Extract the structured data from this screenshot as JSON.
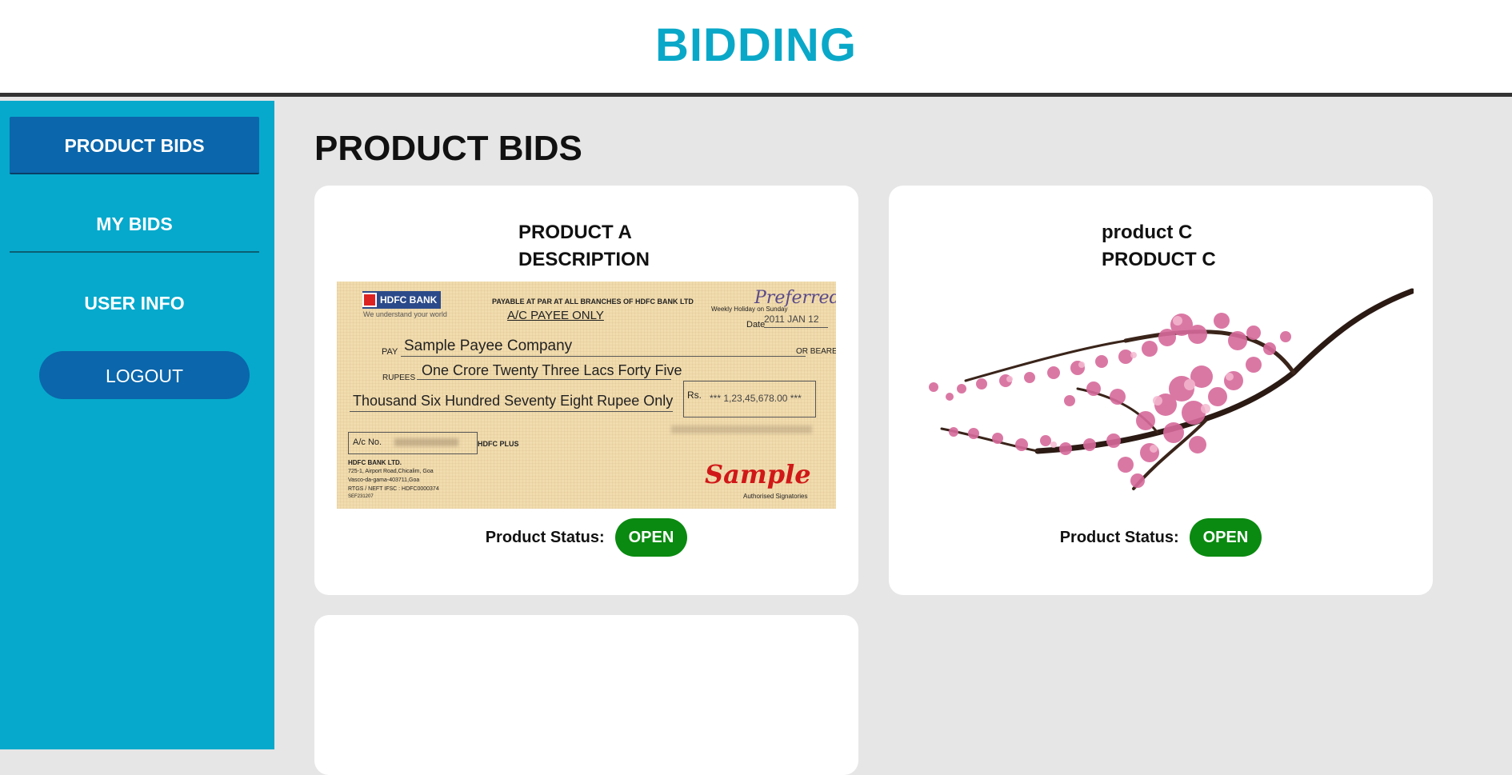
{
  "header": {
    "title": "BIDDING"
  },
  "sidebar": {
    "items": [
      {
        "label": "PRODUCT BIDS"
      },
      {
        "label": "MY BIDS"
      },
      {
        "label": "USER INFO"
      }
    ],
    "logout_label": "LOGOUT"
  },
  "main": {
    "page_title": "PRODUCT BIDS",
    "products": [
      {
        "name": "PRODUCT A",
        "description": "DESCRIPTION",
        "status_label": "Product Status:",
        "status": "OPEN",
        "image": "sample-cheque-image"
      },
      {
        "name": "product C",
        "description": "PRODUCT C",
        "status_label": "Product Status:",
        "status": "OPEN",
        "image": "cherry-blossom-branch-image"
      },
      {
        "name": "",
        "description": "",
        "image": ""
      }
    ]
  },
  "cheque": {
    "bank": "HDFC BANK",
    "tagline": "We understand your world",
    "payable": "PAYABLE AT PAR AT ALL BRANCHES OF HDFC BANK LTD",
    "ac_payee": "A/C PAYEE ONLY",
    "preferred": "Preferred",
    "holiday": "Weekly Holiday on Sunday",
    "date_label": "Date",
    "date": "2011 JAN 12",
    "pay_label": "PAY",
    "payee": "Sample Payee Company",
    "bearer": "OR BEARER",
    "rupees_label": "RUPEES",
    "amount_words_1": "One Crore Twenty Three Lacs Forty Five",
    "amount_words_2": "Thousand Six Hundred Seventy Eight Rupee Only",
    "rs_label": "Rs.",
    "amount": "*** 1,23,45,678.00 ***",
    "ac_no_label": "A/c No.",
    "account_type": "HDFC PLUS",
    "address_1": "HDFC BANK LTD.",
    "address_2": "725-1, Airport Road,Chicalim, Goa",
    "address_3": "Vasco-da-gama-403711,Goa",
    "address_4": "RTGS / NEFT IFSC : HDFC0000374",
    "address_5": "SEF231207",
    "sample": "Sample",
    "signatory": "Authorised Signatories"
  },
  "colors": {
    "title": "#0aa8c8",
    "sidebar": "#06a9cc",
    "active_nav": "#0b66ab",
    "status_open": "#0a8a10",
    "content_bg": "#e6e6e6"
  }
}
